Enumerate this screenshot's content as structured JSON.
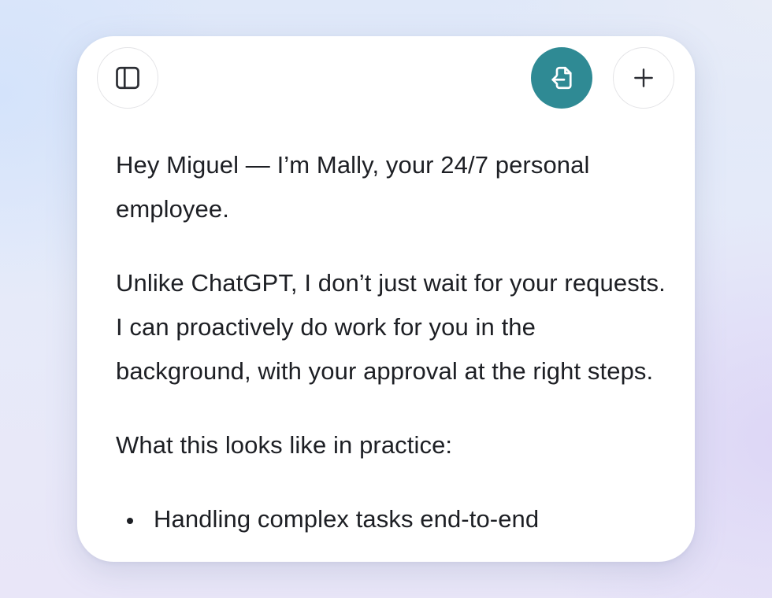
{
  "header": {
    "sidebar_toggle_icon": "sidebar-toggle-icon",
    "action_icon": "file-import-icon",
    "new_icon": "plus-icon",
    "accent_color": "#2f8a94"
  },
  "message": {
    "paragraphs": [
      "Hey Miguel — I’m Mally, your 24/7 personal employee.",
      "Unlike ChatGPT, I don’t just wait for your requests. I can proactively do work for you in the background, with your approval at the right steps.",
      "What this looks like in practice:"
    ],
    "bullets": [
      "Handling complex tasks end-to-end"
    ]
  }
}
